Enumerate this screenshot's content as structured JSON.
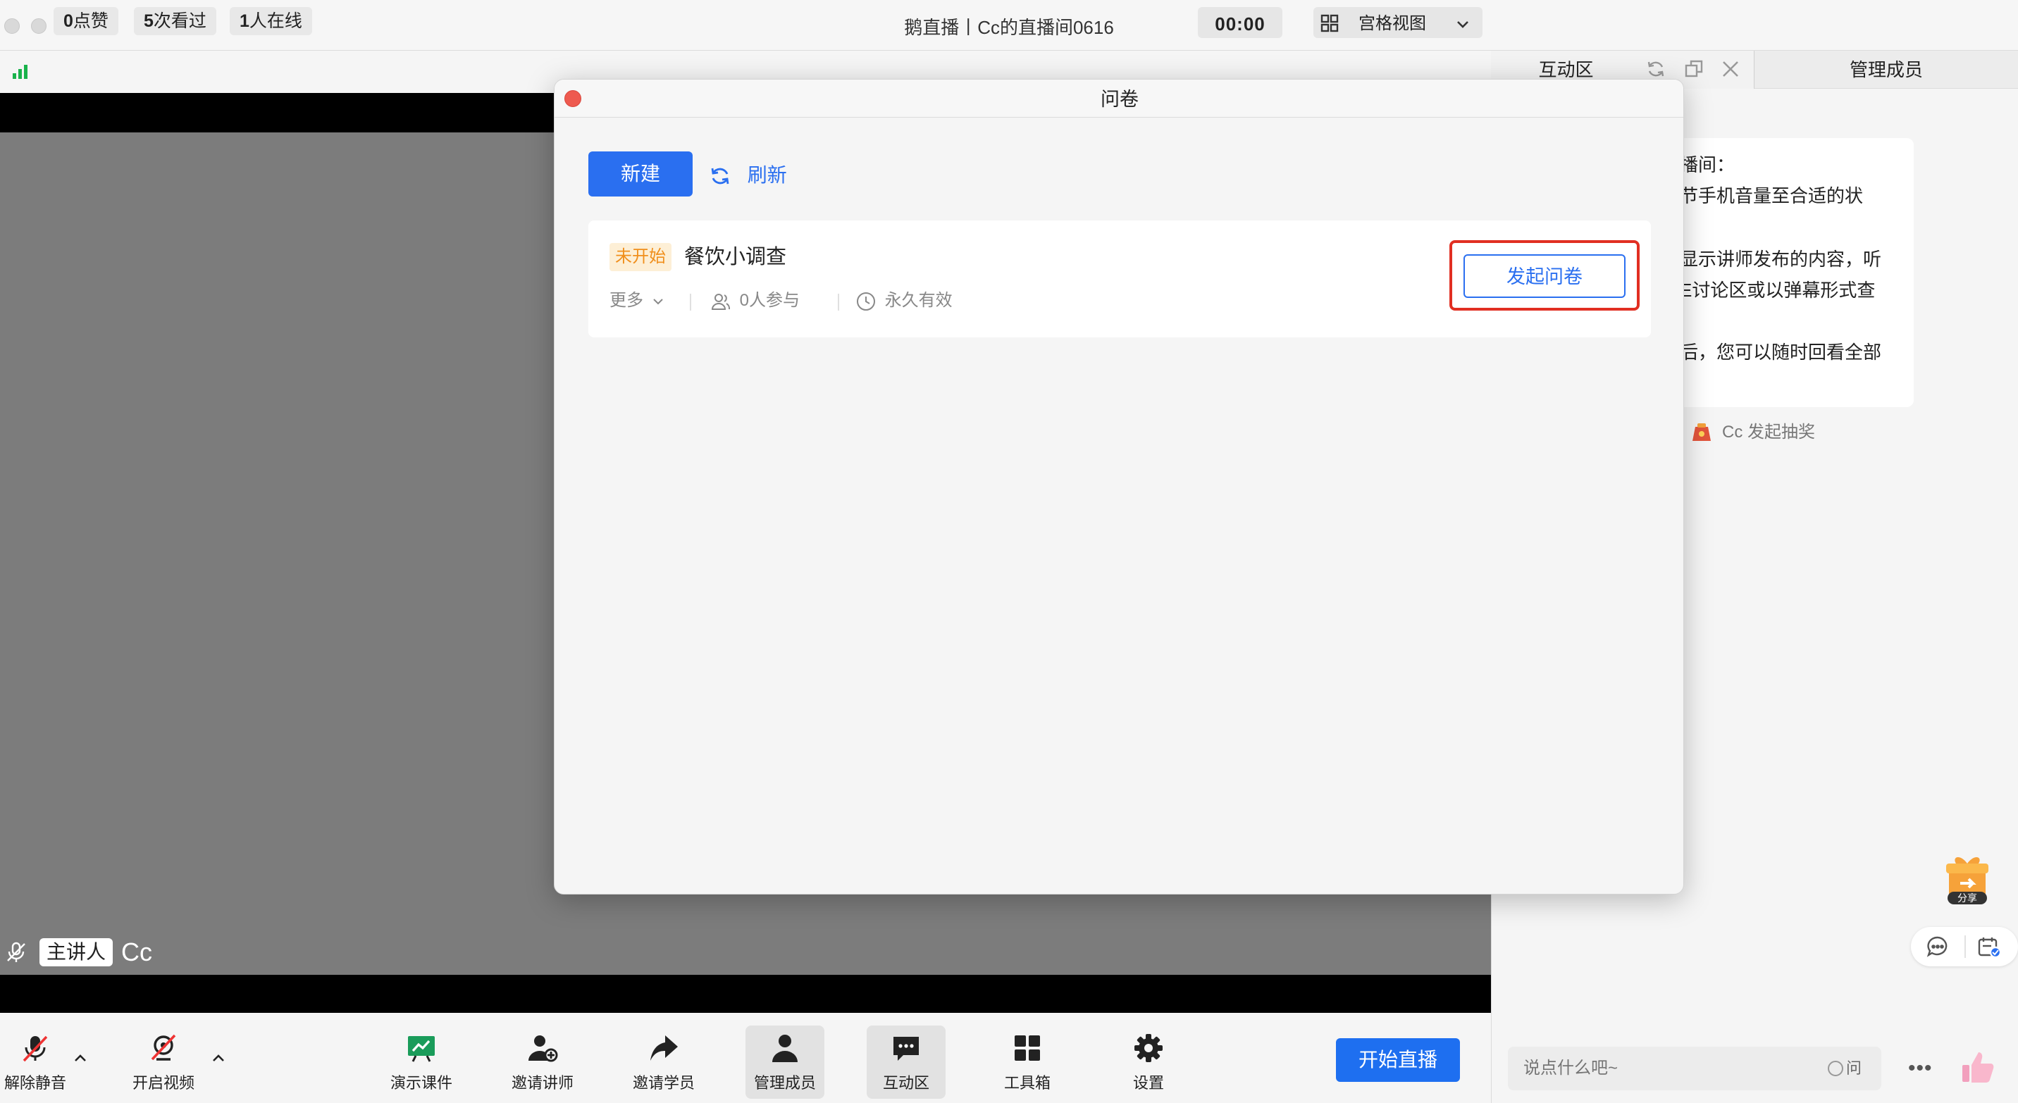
{
  "window": {
    "title": "鹅直播丨Cc的直播间0616"
  },
  "stats": {
    "likes_num": "0",
    "likes_label": "点赞",
    "views_num": "5",
    "views_label": "次看过",
    "online_num": "1",
    "online_label": "人在线",
    "timer": "00:00",
    "view_mode": "宫格视图"
  },
  "video": {
    "presenter_role": "主讲人",
    "presenter_name": "Cc"
  },
  "toolbar": {
    "unmute": "解除静音",
    "video": "开启视频",
    "present": "演示课件",
    "invite_teacher": "邀请讲师",
    "invite_student": "邀请学员",
    "manage_members": "管理成员",
    "interaction": "互动区",
    "toolbox": "工具箱",
    "settings": "设置",
    "start_live": "开始直播"
  },
  "right_panel": {
    "tab_interaction": "互动区",
    "tab_manage": "管理成员",
    "notice_lines": [
      "播间：",
      "节手机音量至合适的状",
      "显示讲师发布的内容，听",
      "E讨论区或以弹幕形式查",
      "后，您可以随时回看全部"
    ],
    "lottery_text": "Cc 发起抽奖",
    "share_label": "分享",
    "chat_placeholder": "说点什么吧~",
    "ask_label": "问",
    "more": "•••"
  },
  "modal": {
    "title": "问卷",
    "new_button": "新建",
    "refresh_button": "刷新",
    "survey": {
      "status": "未开始",
      "name": "餐饮小调查",
      "more": "更多",
      "participants": "0人参与",
      "validity": "永久有效",
      "launch": "发起问卷"
    }
  },
  "colors": {
    "primary": "#2a6ff0",
    "highlight": "#e12f22",
    "status_bg": "#fdefd6",
    "status_text": "#f08f1c",
    "video_bg": "#7c7c7c"
  }
}
